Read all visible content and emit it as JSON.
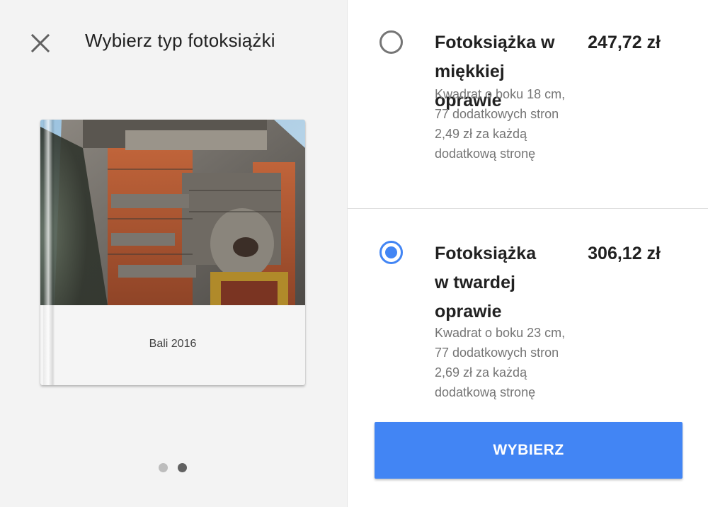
{
  "header": {
    "title": "Wybierz typ fotoksiążki",
    "close_icon": "close-icon"
  },
  "preview": {
    "cover_title": "Bali 2016",
    "pager": {
      "pages": 2,
      "current": 2
    }
  },
  "options": [
    {
      "name": "Fotoksiążka w miękkiej oprawie",
      "price": "247,72 zł",
      "size_line": "Kwadrat o boku 18 cm,",
      "pages_line": "77 dodatkowych stron",
      "extra_line1": "2,49 zł za każdą",
      "extra_line2": "dodatkową stronę",
      "selected": false
    },
    {
      "name": "Fotoksiążka w twardej oprawie",
      "price": "306,12 zł",
      "size_line": "Kwadrat o boku 23 cm,",
      "pages_line": "77 dodatkowych stron",
      "extra_line1": "2,69 zł za każdą",
      "extra_line2": "dodatkową stronę",
      "selected": true
    }
  ],
  "actions": {
    "select_label": "WYBIERZ"
  },
  "colors": {
    "accent": "#4285f4",
    "left_bg": "#f3f3f3",
    "text_primary": "#212121",
    "text_secondary": "#757575"
  }
}
